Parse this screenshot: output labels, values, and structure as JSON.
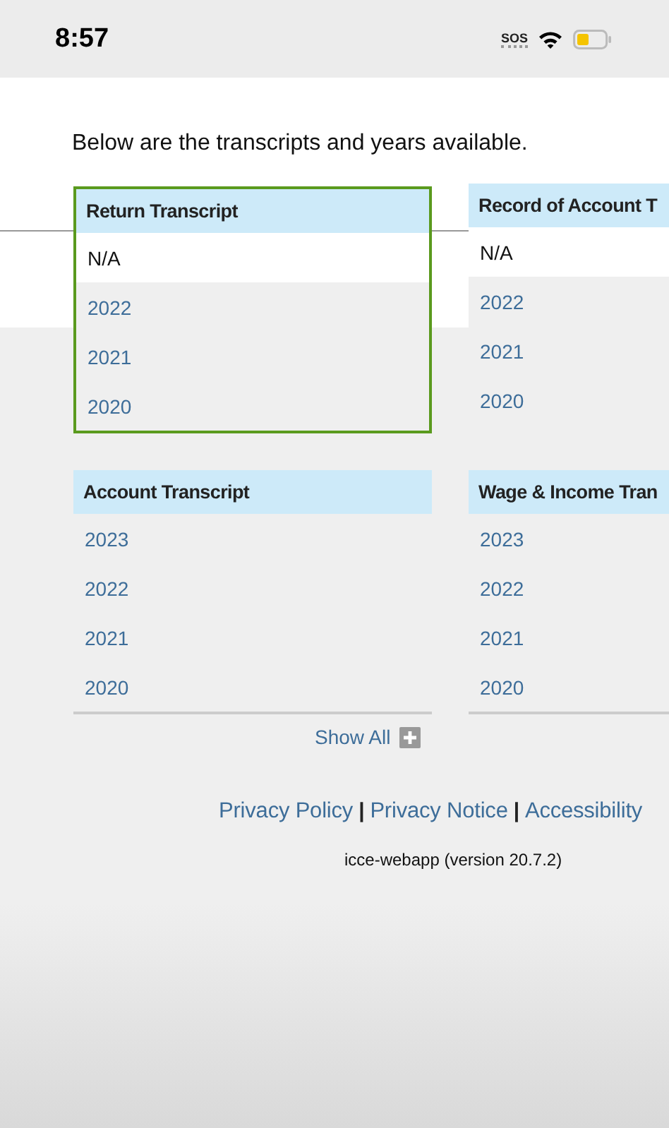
{
  "status_bar": {
    "time": "8:57",
    "sos": "SOS"
  },
  "intro": "Below are the transcripts and years available.",
  "cards": [
    {
      "title": "Return Transcript",
      "selected": true,
      "rows": [
        {
          "kind": "text",
          "label": "N/A"
        },
        {
          "kind": "link",
          "label": "2022"
        },
        {
          "kind": "link",
          "label": "2021"
        },
        {
          "kind": "link",
          "label": "2020"
        }
      ]
    },
    {
      "title": "Record of Account T",
      "selected": false,
      "rows": [
        {
          "kind": "text",
          "label": "N/A"
        },
        {
          "kind": "link",
          "label": "2022"
        },
        {
          "kind": "link",
          "label": "2021"
        },
        {
          "kind": "link",
          "label": "2020"
        }
      ]
    },
    {
      "title": "Account Transcript",
      "selected": false,
      "rows": [
        {
          "kind": "link",
          "label": "2023"
        },
        {
          "kind": "link",
          "label": "2022"
        },
        {
          "kind": "link",
          "label": "2021"
        },
        {
          "kind": "link",
          "label": "2020"
        }
      ]
    },
    {
      "title": "Wage & Income Tran",
      "selected": false,
      "rows": [
        {
          "kind": "link",
          "label": "2023"
        },
        {
          "kind": "link",
          "label": "2022"
        },
        {
          "kind": "link",
          "label": "2021"
        },
        {
          "kind": "link",
          "label": "2020"
        }
      ]
    }
  ],
  "show_all": "Show All",
  "footer_links": [
    "Privacy Policy",
    "Privacy Notice",
    "Accessibility"
  ],
  "separator": "|",
  "version": "icce-webapp (version 20.7.2)"
}
